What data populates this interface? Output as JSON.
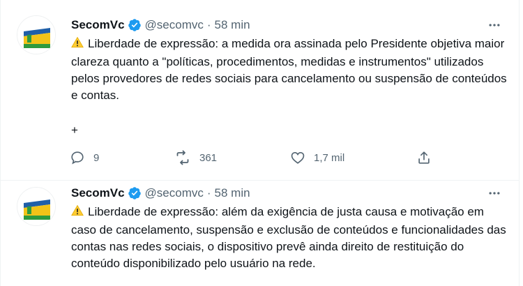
{
  "tweets": [
    {
      "name": "SecomVc",
      "handle": "@secomvc",
      "separator": "·",
      "time": "58 min",
      "text": "Liberdade de expressão: a medida ora assinada pelo Presidente objetiva maior clareza quanto a \"políticas, procedimentos, medidas e instrumentos\" utilizados pelos provedores de redes sociais para cancelamento ou suspensão de conteúdos e contas.",
      "thread_marker": "+",
      "replies": "9",
      "retweets": "361",
      "likes": "1,7 mil"
    },
    {
      "name": "SecomVc",
      "handle": "@secomvc",
      "separator": "·",
      "time": "58 min",
      "text": "Liberdade de expressão: além da exigência de justa causa e motivação em caso de cancelamento, suspensão e exclusão de conteúdos e funcionalidades das contas nas redes sociais, o dispositivo prevê ainda direito de restituição do conteúdo disponibilizado pelo usuário na rede."
    }
  ],
  "icons": {
    "verified": "verified-badge-icon",
    "warning": "warning-sign-icon",
    "more": "more-options-icon",
    "reply": "reply-icon",
    "retweet": "retweet-icon",
    "like": "like-icon",
    "share": "share-icon"
  },
  "colors": {
    "text": "#0f1419",
    "secondary": "#536471",
    "verified_blue": "#1d9bf0",
    "divider": "#eff3f4"
  }
}
